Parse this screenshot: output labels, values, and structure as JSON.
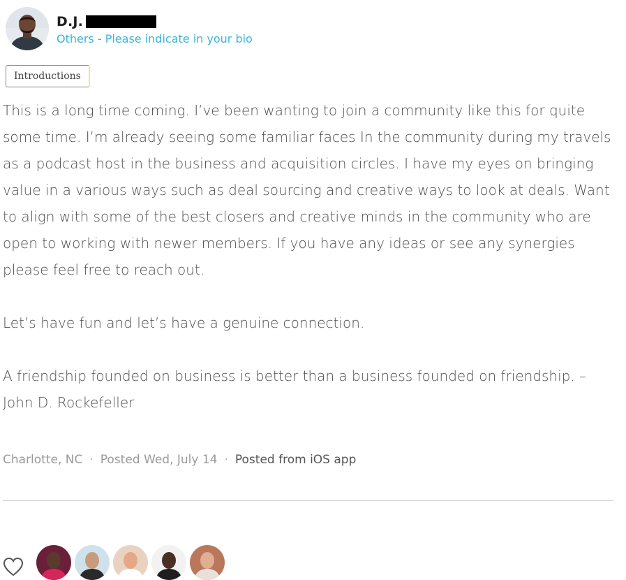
{
  "post": {
    "author": {
      "first_name": "D.J.",
      "role": "Others - Please indicate in your bio",
      "avatar": "avatar-photo"
    },
    "category_tag": "Introductions",
    "paragraphs": [
      "This is a long time coming. I’ve been wanting to join a community like this for quite some time. I’m already seeing some familiar faces In the community during my travels as a podcast host in the business and acquisition circles. I have my eyes on bringing value in a various ways such as deal sourcing and creative ways to look at deals. Want to align with some of the best closers and creative minds in the community who are open to working with newer members. If you have any ideas or see any synergies please feel free to reach out.",
      "Let’s have fun and let’s have a genuine connection.",
      "A friendship founded on business is better than a business founded on friendship. – John D. Rockefeller"
    ],
    "meta": {
      "location": "Charlotte, NC",
      "posted": "Posted Wed, July 14",
      "source": "Posted from iOS app"
    }
  },
  "reactions": {
    "like_icon": "heart-icon",
    "likers": [
      {
        "name": "liker-avatar-1",
        "bg": "#6a1f3a",
        "skin": "#5b3a2e",
        "shirt": "#d6255b"
      },
      {
        "name": "liker-avatar-2",
        "bg": "#cfe1ea",
        "skin": "#c99a7e",
        "shirt": "#2a2a2a"
      },
      {
        "name": "liker-avatar-3",
        "bg": "#e9d3c0",
        "skin": "#e5a787",
        "shirt": "#ffffff"
      },
      {
        "name": "liker-avatar-4",
        "bg": "#f2f2f2",
        "skin": "#4a2f24",
        "shirt": "#1f1f1f"
      },
      {
        "name": "liker-avatar-5",
        "bg": "#b9775c",
        "skin": "#e0ae93",
        "shirt": "#e9e0d8"
      }
    ]
  },
  "colors": {
    "accent_link": "#38b6d6",
    "text": "#4d4d4d",
    "meta_text": "#9a9a9a"
  }
}
